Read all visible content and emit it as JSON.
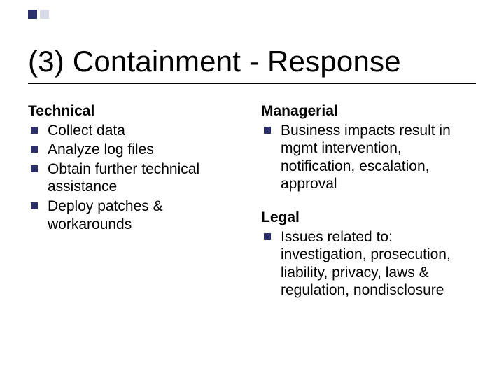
{
  "title": "(3) Containment - Response",
  "left": {
    "heading": "Technical",
    "items": [
      "Collect data",
      "Analyze log files",
      "Obtain further technical assistance",
      "Deploy patches & workarounds"
    ]
  },
  "right": {
    "section1": {
      "heading": "Managerial",
      "items": [
        "Business impacts result in mgmt intervention, notification, escalation, approval"
      ]
    },
    "section2": {
      "heading": "Legal",
      "items": [
        "Issues related to: investigation, prosecution, liability, privacy, laws & regulation, nondisclosure"
      ]
    }
  }
}
